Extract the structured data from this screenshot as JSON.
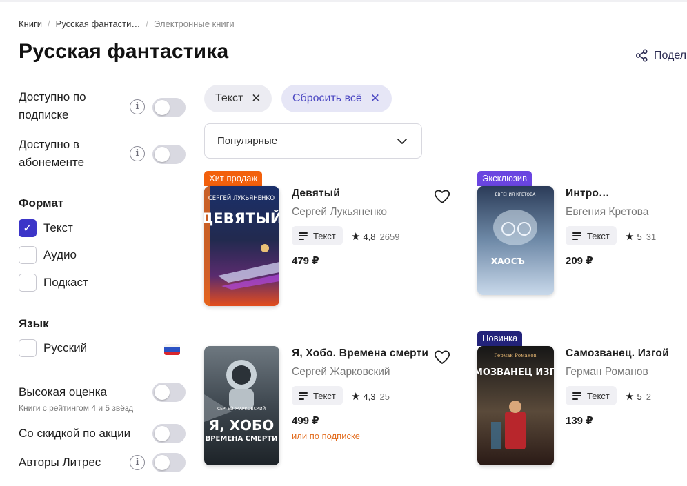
{
  "breadcrumb": [
    "Книги",
    "Русская фантасти…",
    "Электронные книги"
  ],
  "page_title": "Русская фантастика",
  "share_label": "Подел",
  "sidebar": {
    "subscription_label": "Доступно по подписке",
    "abonement_label": "Доступно в абонементе",
    "format_title": "Формат",
    "formats": [
      {
        "label": "Текст",
        "checked": true
      },
      {
        "label": "Аудио",
        "checked": false
      },
      {
        "label": "Подкаст",
        "checked": false
      }
    ],
    "language_title": "Язык",
    "language_option": "Русский",
    "high_rating_label": "Высокая оценка",
    "high_rating_note": "Книги с рейтингом 4 и 5 звёзд",
    "discount_label": "Со скидкой по акции",
    "litres_authors_label": "Авторы Литрес"
  },
  "filters": {
    "active_chip": "Текст",
    "reset_chip": "Сбросить всё",
    "sort_value": "Популярные"
  },
  "books": [
    {
      "badge": "Хит продаж",
      "badge_color": "#f2600c",
      "title": "Девятый",
      "author": "Сергей Лукьяненко",
      "format": "Текст",
      "rating": "4,8",
      "rating_count": "2659",
      "price": "479 ₽",
      "cover_author": "СЕРГЕЙ ЛУКЬЯНЕНКО",
      "cover_title": "ДЕВЯТЫЙ"
    },
    {
      "badge": "Эксклюзив",
      "badge_color": "#6a45e0",
      "title": "Интро…",
      "author": "Евгения Кретова",
      "format": "Текст",
      "rating": "5",
      "rating_count": "31",
      "price": "209 ₽",
      "cover_author": "ЕВГЕНИЯ КРЕТОВА",
      "cover_title": "ХАОСЪ"
    },
    {
      "badge": "",
      "title": "Я, Хобо. Времена смерти",
      "author": "Сергей Жарковский",
      "format": "Текст",
      "rating": "4,3",
      "rating_count": "25",
      "price": "499 ₽",
      "sub_price": "или по подписке",
      "cover_author": "СЕРГЕЙ ЖАРКОВСКИЙ",
      "cover_title": "Я, ХОБО",
      "cover_subtitle": "ВРЕМЕНА СМЕРТИ"
    },
    {
      "badge": "Новинка",
      "badge_color": "#23237a",
      "title": "Самозванец. Изгой",
      "author": "Герман Романов",
      "format": "Текст",
      "rating": "5",
      "rating_count": "2",
      "price": "139 ₽",
      "cover_author": "Герман Романов",
      "cover_title": "САМОЗВАНЕЦ ИЗГОЙ"
    }
  ]
}
